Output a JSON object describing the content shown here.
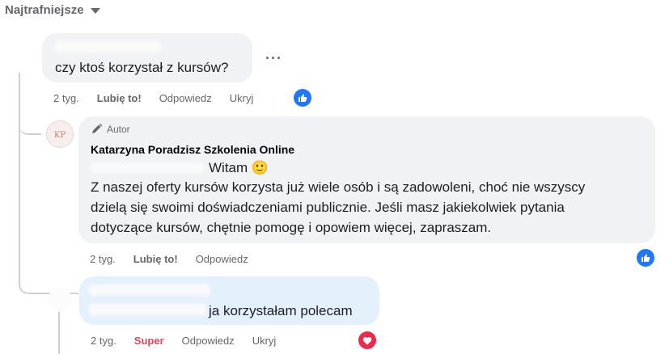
{
  "sort": {
    "label": "Najtrafniejsze",
    "icon": "caret-down-icon"
  },
  "comments": [
    {
      "text": "czy ktoś korzystał z kursów?",
      "time": "2 tyg.",
      "like_label": "Lubię to!",
      "reply_label": "Odpowiedz",
      "hide_label": "Ukryj",
      "more_label": "···",
      "reaction_icon": "like-icon"
    },
    {
      "badge_icon": "pencil-icon",
      "badge_label": "Autor",
      "author": "Katarzyna Poradzisz Szkolenia Online",
      "greeting": "Witam",
      "emoji": "🙂",
      "lines": [
        "Z naszej oferty kursów korzysta już wiele osób i są zadowoleni, choć nie wszyscy",
        "dzielą się swoimi doświadczeniami publicznie. Jeśli masz jakiekolwiek pytania",
        "dotyczące kursów, chętnie pomogę i opowiem więcej, zapraszam."
      ],
      "time": "2 tyg.",
      "like_label": "Lubię to!",
      "reply_label": "Odpowiedz",
      "reaction_icon": "like-icon"
    },
    {
      "text": "ja korzystałam polecam",
      "time": "2 tyg.",
      "reaction_label": "Super",
      "reply_label": "Odpowiedz",
      "hide_label": "Ukryj",
      "reaction_icon": "heart-icon"
    }
  ],
  "colors": {
    "bubble": "#f0f2f5",
    "bubble_highlight": "#e5f0fd",
    "like_blue": "#2078f4",
    "love_red": "#f0284a",
    "secondary_text": "#65676b",
    "super_text": "#e4445a"
  }
}
